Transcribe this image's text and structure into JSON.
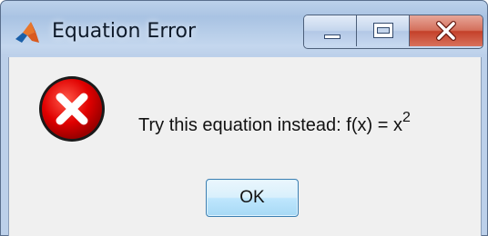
{
  "window": {
    "title": "Equation Error",
    "app_icon": "matlab-logo-icon",
    "caption_buttons": {
      "minimize_icon": "minimize-icon",
      "maximize_icon": "maximize-icon",
      "close_icon": "close-icon",
      "close_color": "#c7462e"
    }
  },
  "dialog": {
    "icon": "error-icon",
    "icon_color": "#d50000",
    "message_prefix": "Try this equation instead: f(x) = x",
    "message_superscript": "2",
    "ok_label": "OK"
  }
}
